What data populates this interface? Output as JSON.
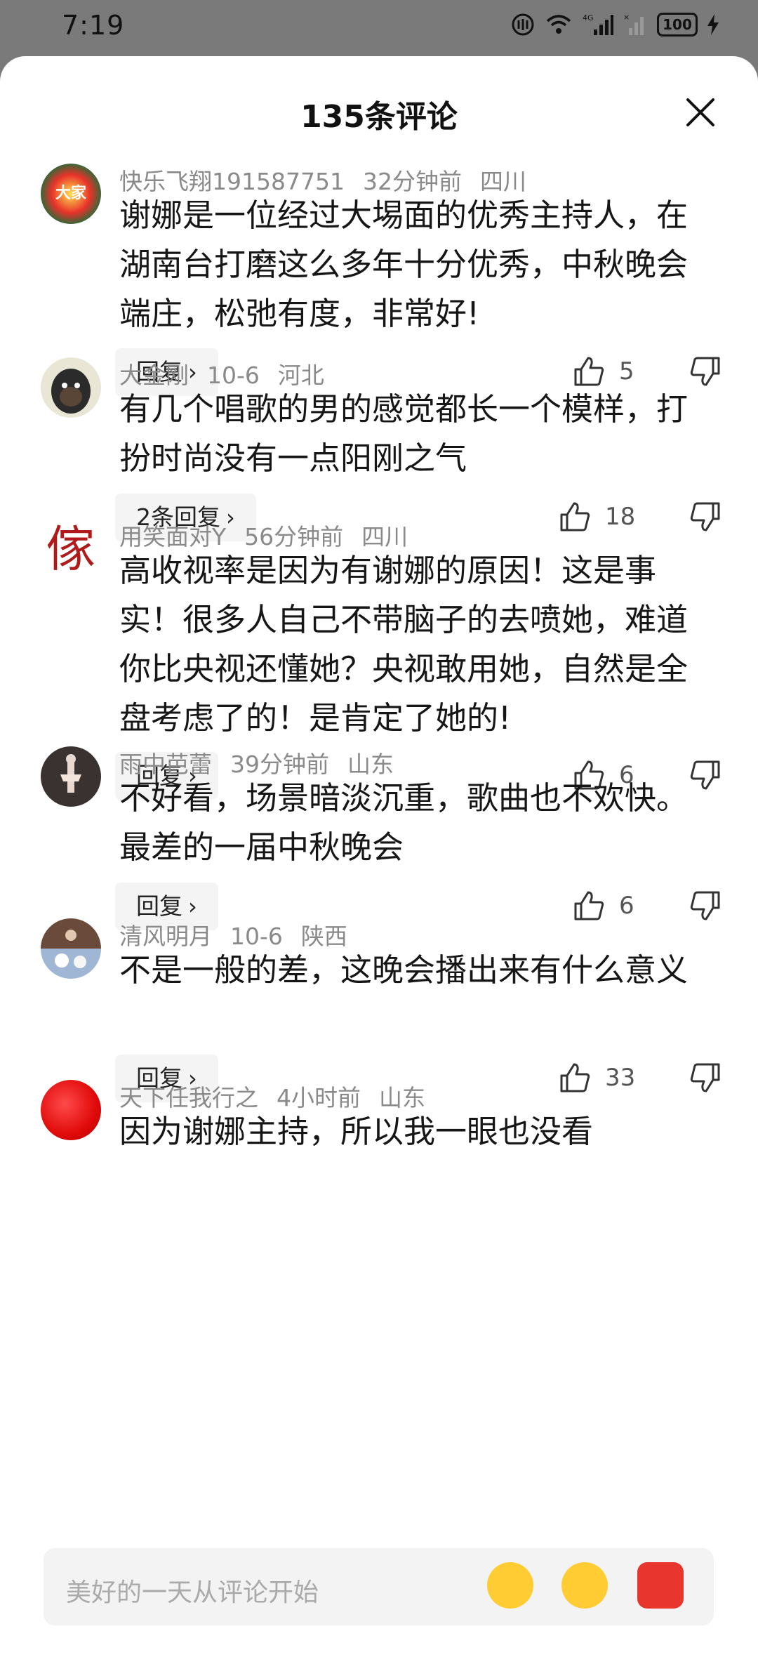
{
  "status_bar": {
    "time": "7:19",
    "battery": "100"
  },
  "sheet": {
    "title": "135条评论"
  },
  "comments": [
    {
      "user": "快乐飞翔191587751",
      "time": "32分钟前",
      "location": "四川",
      "text": "谢娜是一位经过大埸面的优秀主持人，在湖南台打磨这么多年十分优秀，中秋晚会端庄，松弛有度，非常好!",
      "reply": "回复",
      "likes": "5"
    },
    {
      "user": "大金刚",
      "time": "10-6",
      "location": "河北",
      "text": "有几个唱歌的男的感觉都长一个模样，打扮时尚没有一点阳刚之气",
      "reply": "2条回复",
      "likes": "18"
    },
    {
      "user": "用笑面对Y",
      "time": "56分钟前",
      "location": "四川",
      "text": "高收视率是因为有谢娜的原因！这是事实！很多人自己不带脑子的去喷她，难道你比央视还懂她？央视敢用她，自然是全盘考虑了的！是肯定了她的!",
      "reply": "回复",
      "likes": "6"
    },
    {
      "user": "雨中芭蕾",
      "time": "39分钟前",
      "location": "山东",
      "text": "不好看，场景暗淡沉重，歌曲也不欢快。最差的一届中秋晚会",
      "reply": "回复",
      "likes": "6"
    },
    {
      "user": "清风明月",
      "time": "10-6",
      "location": "陕西",
      "text": "不是一般的差，这晚会播出来有什么意义",
      "reply": "回复",
      "likes": "33"
    },
    {
      "user": "天下任我行之",
      "time": "4小时前",
      "location": "山东",
      "text": "因为谢娜主持，所以我一眼也没看"
    }
  ],
  "input": {
    "placeholder": "美好的一天从评论开始"
  },
  "colors": {
    "meta": "#8a8a8a",
    "reply_bg": "#f4f4f4",
    "input_bg": "#f3f3f3"
  }
}
